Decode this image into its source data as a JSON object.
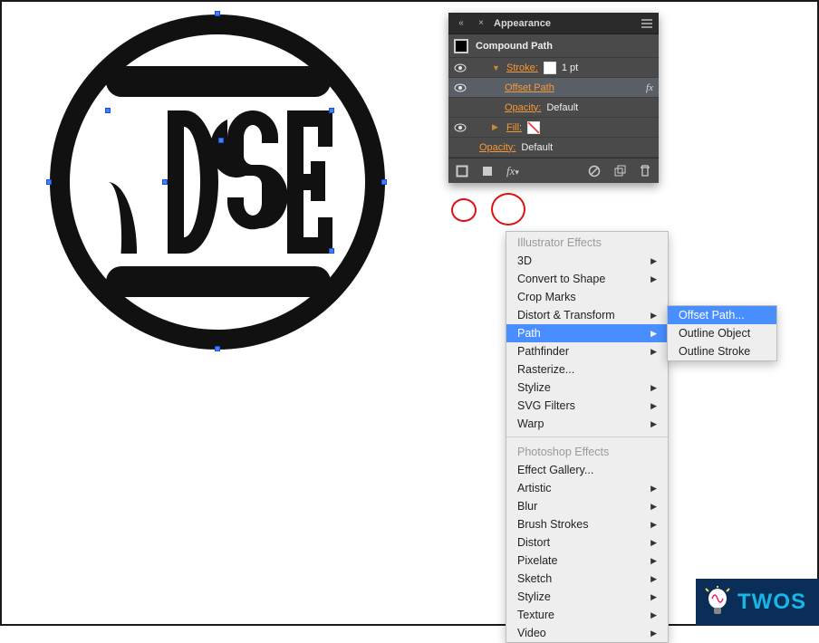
{
  "panel": {
    "title": "Appearance",
    "objectType": "Compound Path",
    "rows": [
      {
        "name": "stroke",
        "eye": true,
        "expand": true,
        "indent": 1,
        "labelLink": "Stroke:",
        "swatch": "white",
        "value": "1 pt"
      },
      {
        "name": "offset-path",
        "eye": true,
        "expand": false,
        "indent": 2,
        "labelLink": "Offset Path",
        "fx": true,
        "selected": true
      },
      {
        "name": "stroke-opac",
        "eye": false,
        "expand": false,
        "indent": 2,
        "labelLink": "Opacity:",
        "value": "Default"
      },
      {
        "name": "fill",
        "eye": true,
        "expand": false,
        "indent": 1,
        "labelLink": "Fill:",
        "swatch": "none"
      },
      {
        "name": "obj-opac",
        "eye": false,
        "expand": false,
        "indent": 0,
        "labelLink": "Opacity:",
        "value": "Default"
      }
    ],
    "footer": {
      "newStroke": "add-stroke-button",
      "newFill": "add-fill-button",
      "fx": "fx",
      "clear": "clear-appearance-button",
      "dup": "duplicate-item-button",
      "trash": "delete-item-button"
    }
  },
  "effectsMenu": {
    "sections": [
      {
        "header": "Illustrator Effects",
        "items": [
          {
            "label": "3D",
            "submenu": true
          },
          {
            "label": "Convert to Shape",
            "submenu": true
          },
          {
            "label": "Crop Marks"
          },
          {
            "label": "Distort & Transform",
            "submenu": true
          },
          {
            "label": "Path",
            "submenu": true,
            "highlight": true
          },
          {
            "label": "Pathfinder",
            "submenu": true
          },
          {
            "label": "Rasterize..."
          },
          {
            "label": "Stylize",
            "submenu": true
          },
          {
            "label": "SVG Filters",
            "submenu": true
          },
          {
            "label": "Warp",
            "submenu": true
          }
        ]
      },
      {
        "header": "Photoshop Effects",
        "items": [
          {
            "label": "Effect Gallery..."
          },
          {
            "label": "Artistic",
            "submenu": true
          },
          {
            "label": "Blur",
            "submenu": true
          },
          {
            "label": "Brush Strokes",
            "submenu": true
          },
          {
            "label": "Distort",
            "submenu": true
          },
          {
            "label": "Pixelate",
            "submenu": true
          },
          {
            "label": "Sketch",
            "submenu": true
          },
          {
            "label": "Stylize",
            "submenu": true
          },
          {
            "label": "Texture",
            "submenu": true
          },
          {
            "label": "Video",
            "submenu": true
          }
        ]
      }
    ],
    "pathSubmenu": [
      {
        "label": "Offset Path...",
        "highlight": true
      },
      {
        "label": "Outline Object"
      },
      {
        "label": "Outline Stroke"
      }
    ]
  },
  "watermark": {
    "text": "TWOS"
  },
  "logo": {
    "text": "CDSE"
  }
}
